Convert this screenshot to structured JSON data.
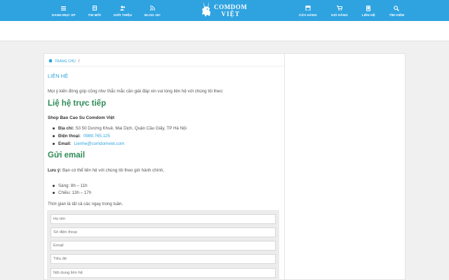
{
  "header": {
    "nav_left": [
      {
        "label": "DANH MỤC SP",
        "icon": "menu-icon"
      },
      {
        "label": "TIN MỚI",
        "icon": "document-icon"
      },
      {
        "label": "GIỚI THIỆU",
        "icon": "users-icon"
      },
      {
        "label": "BLOG 18+",
        "icon": "rss-icon"
      }
    ],
    "logo": {
      "line1": "COMDOM",
      "line2": "VIỆT"
    },
    "nav_right": [
      {
        "label": "CỬA HÀNG",
        "icon": "store-icon"
      },
      {
        "label": "GIỎ HÀNG",
        "icon": "cart-icon"
      },
      {
        "label": "LIÊN HỆ",
        "icon": "phone-icon"
      },
      {
        "label": "TÌM KIẾM",
        "icon": "search-icon"
      }
    ],
    "brand_color": "#2fa3e0"
  },
  "breadcrumb": {
    "home": "TRANG CHỦ",
    "separator": "/"
  },
  "content": {
    "title": "LIÊN HỆ",
    "intro": "Mọi ý kiến đóng góp cũng như thắc mắc cần giải đáp xin vui lòng liên hệ với chúng tôi theo:",
    "heading_direct": "Liệ hệ trực tiếp",
    "shop_name": "Shop Bao Cao Su Comdom Việt",
    "address_label": "Địa chỉ:",
    "address_value": "Số 50 Dương Khuê, Mai Dịch, Quận Cầu Giấy, TP Hà Nội",
    "phone_label": "Điện thoại:",
    "phone_value": "0989.765.125",
    "email_label": "Email:",
    "email_value": "Lienhe@comdomviet.com",
    "heading_email": "Gửi email",
    "note_label": "Lưu ý:",
    "note_text": "Bạn có thể liên hệ với chúng tôi theo giờ hành chính,",
    "hours": [
      "Sáng: 8h – 11h",
      "Chiều: 13h – 17h"
    ],
    "weekly": "Thời gian là tất cả các ngay trong tuần."
  },
  "form": {
    "name_placeholder": "Họ tên",
    "phone_placeholder": "Số điện thoại",
    "email_placeholder": "Email",
    "subject_placeholder": "Tiêu đề",
    "message_placeholder": "Nội dung liên hệ"
  }
}
